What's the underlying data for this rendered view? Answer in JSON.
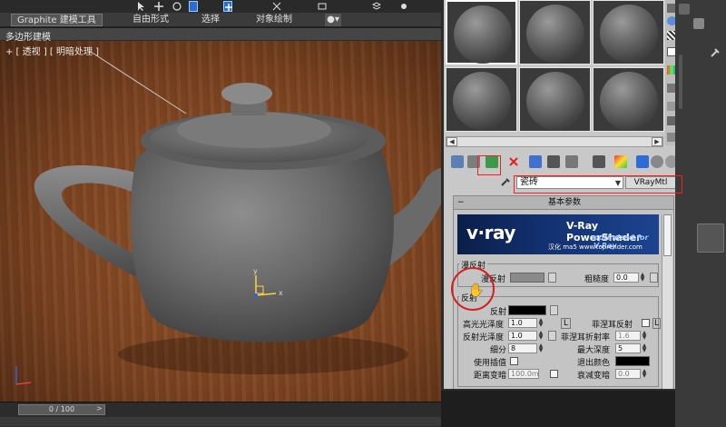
{
  "ribbon": {
    "tabs": [
      "Graphite 建模工具",
      "自由形式",
      "选择",
      "对象绘制"
    ],
    "sub_label": "多边形建模"
  },
  "viewport": {
    "label": "+ [ 透视 ] [ 明暗处理 ]",
    "gizmo_x": "x",
    "gizmo_y": "y"
  },
  "timeline": {
    "frame": "0 / 100"
  },
  "material_editor": {
    "material_name": "瓷砖",
    "material_type": "VRayMtl",
    "rollout_title": "基本参数",
    "banner": {
      "logo": "v·ray",
      "title": "V-Ray PowerShader",
      "subtitle": "optimized for V-Ray",
      "credit": "汉化 ma5 www.toprender.com"
    },
    "diffuse": {
      "group": "漫反射",
      "diffuse_label": "漫反射",
      "roughness_label": "粗糙度",
      "roughness_value": "0.0",
      "diffuse_color": "#8a8a8a"
    },
    "reflection": {
      "group": "反射",
      "reflect_label": "反射",
      "reflect_color": "#000000",
      "hilight_gloss_label": "高光光泽度",
      "hilight_gloss_value": "1.0",
      "lock_label": "L",
      "refl_gloss_label": "反射光泽度",
      "refl_gloss_value": "1.0",
      "subdivs_label": "细分",
      "subdivs_value": "8",
      "use_interp_label": "使用插值",
      "dim_dist_label": "距离变暗",
      "dim_dist_value": "100.0m",
      "fresnel_label": "菲涅耳反射",
      "lock2_label": "L",
      "fresnel_ior_label": "菲涅耳折射率",
      "fresnel_ior_value": "1.6",
      "max_depth_label": "最大深度",
      "max_depth_value": "5",
      "exit_color_label": "退出颜色",
      "exit_color": "#000000",
      "dim_falloff_label": "衰减变暗",
      "dim_falloff_value": "0.0"
    }
  },
  "colors": {
    "annotation_red": "#d42020",
    "vray_blue": "#12306e"
  }
}
